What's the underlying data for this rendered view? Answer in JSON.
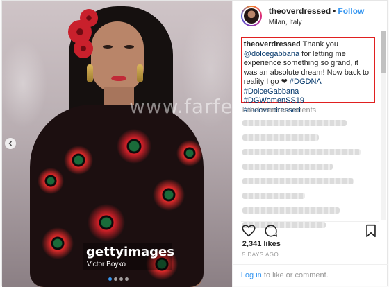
{
  "photo": {
    "watermark": "www.farfesh.com",
    "getty_logo": "gettyimages",
    "getty_credit": "Victor Boyko",
    "carousel_dots": 4,
    "carousel_active_index": 0
  },
  "header": {
    "username": "theoverdressed",
    "separator": "•",
    "follow_label": "Follow",
    "location": "Milan, Italy"
  },
  "caption": {
    "username": "theoverdressed",
    "text_before_mention": "Thank you",
    "mention": "@dolcegabbana",
    "text_after_mention": "for letting me experience something so grand, it was an absolute dream! Now back to reality I go",
    "heart": "❤",
    "tag_inline": "#DGDNA",
    "tags": [
      "#DolceGabbana",
      "#DGWomenSS19",
      "#theoverdressed"
    ]
  },
  "comments": {
    "load_more_label": "Load more comments"
  },
  "stats": {
    "likes": "2,341 likes",
    "time": "5 DAYS AGO"
  },
  "login": {
    "link": "Log in",
    "rest": "to like or comment."
  },
  "colors": {
    "accent": "#3897f0",
    "highlight_box": "#e02020",
    "hashtag": "#003569"
  },
  "icons": [
    "chevron-left-icon",
    "heart-icon",
    "comment-icon",
    "bookmark-icon"
  ]
}
